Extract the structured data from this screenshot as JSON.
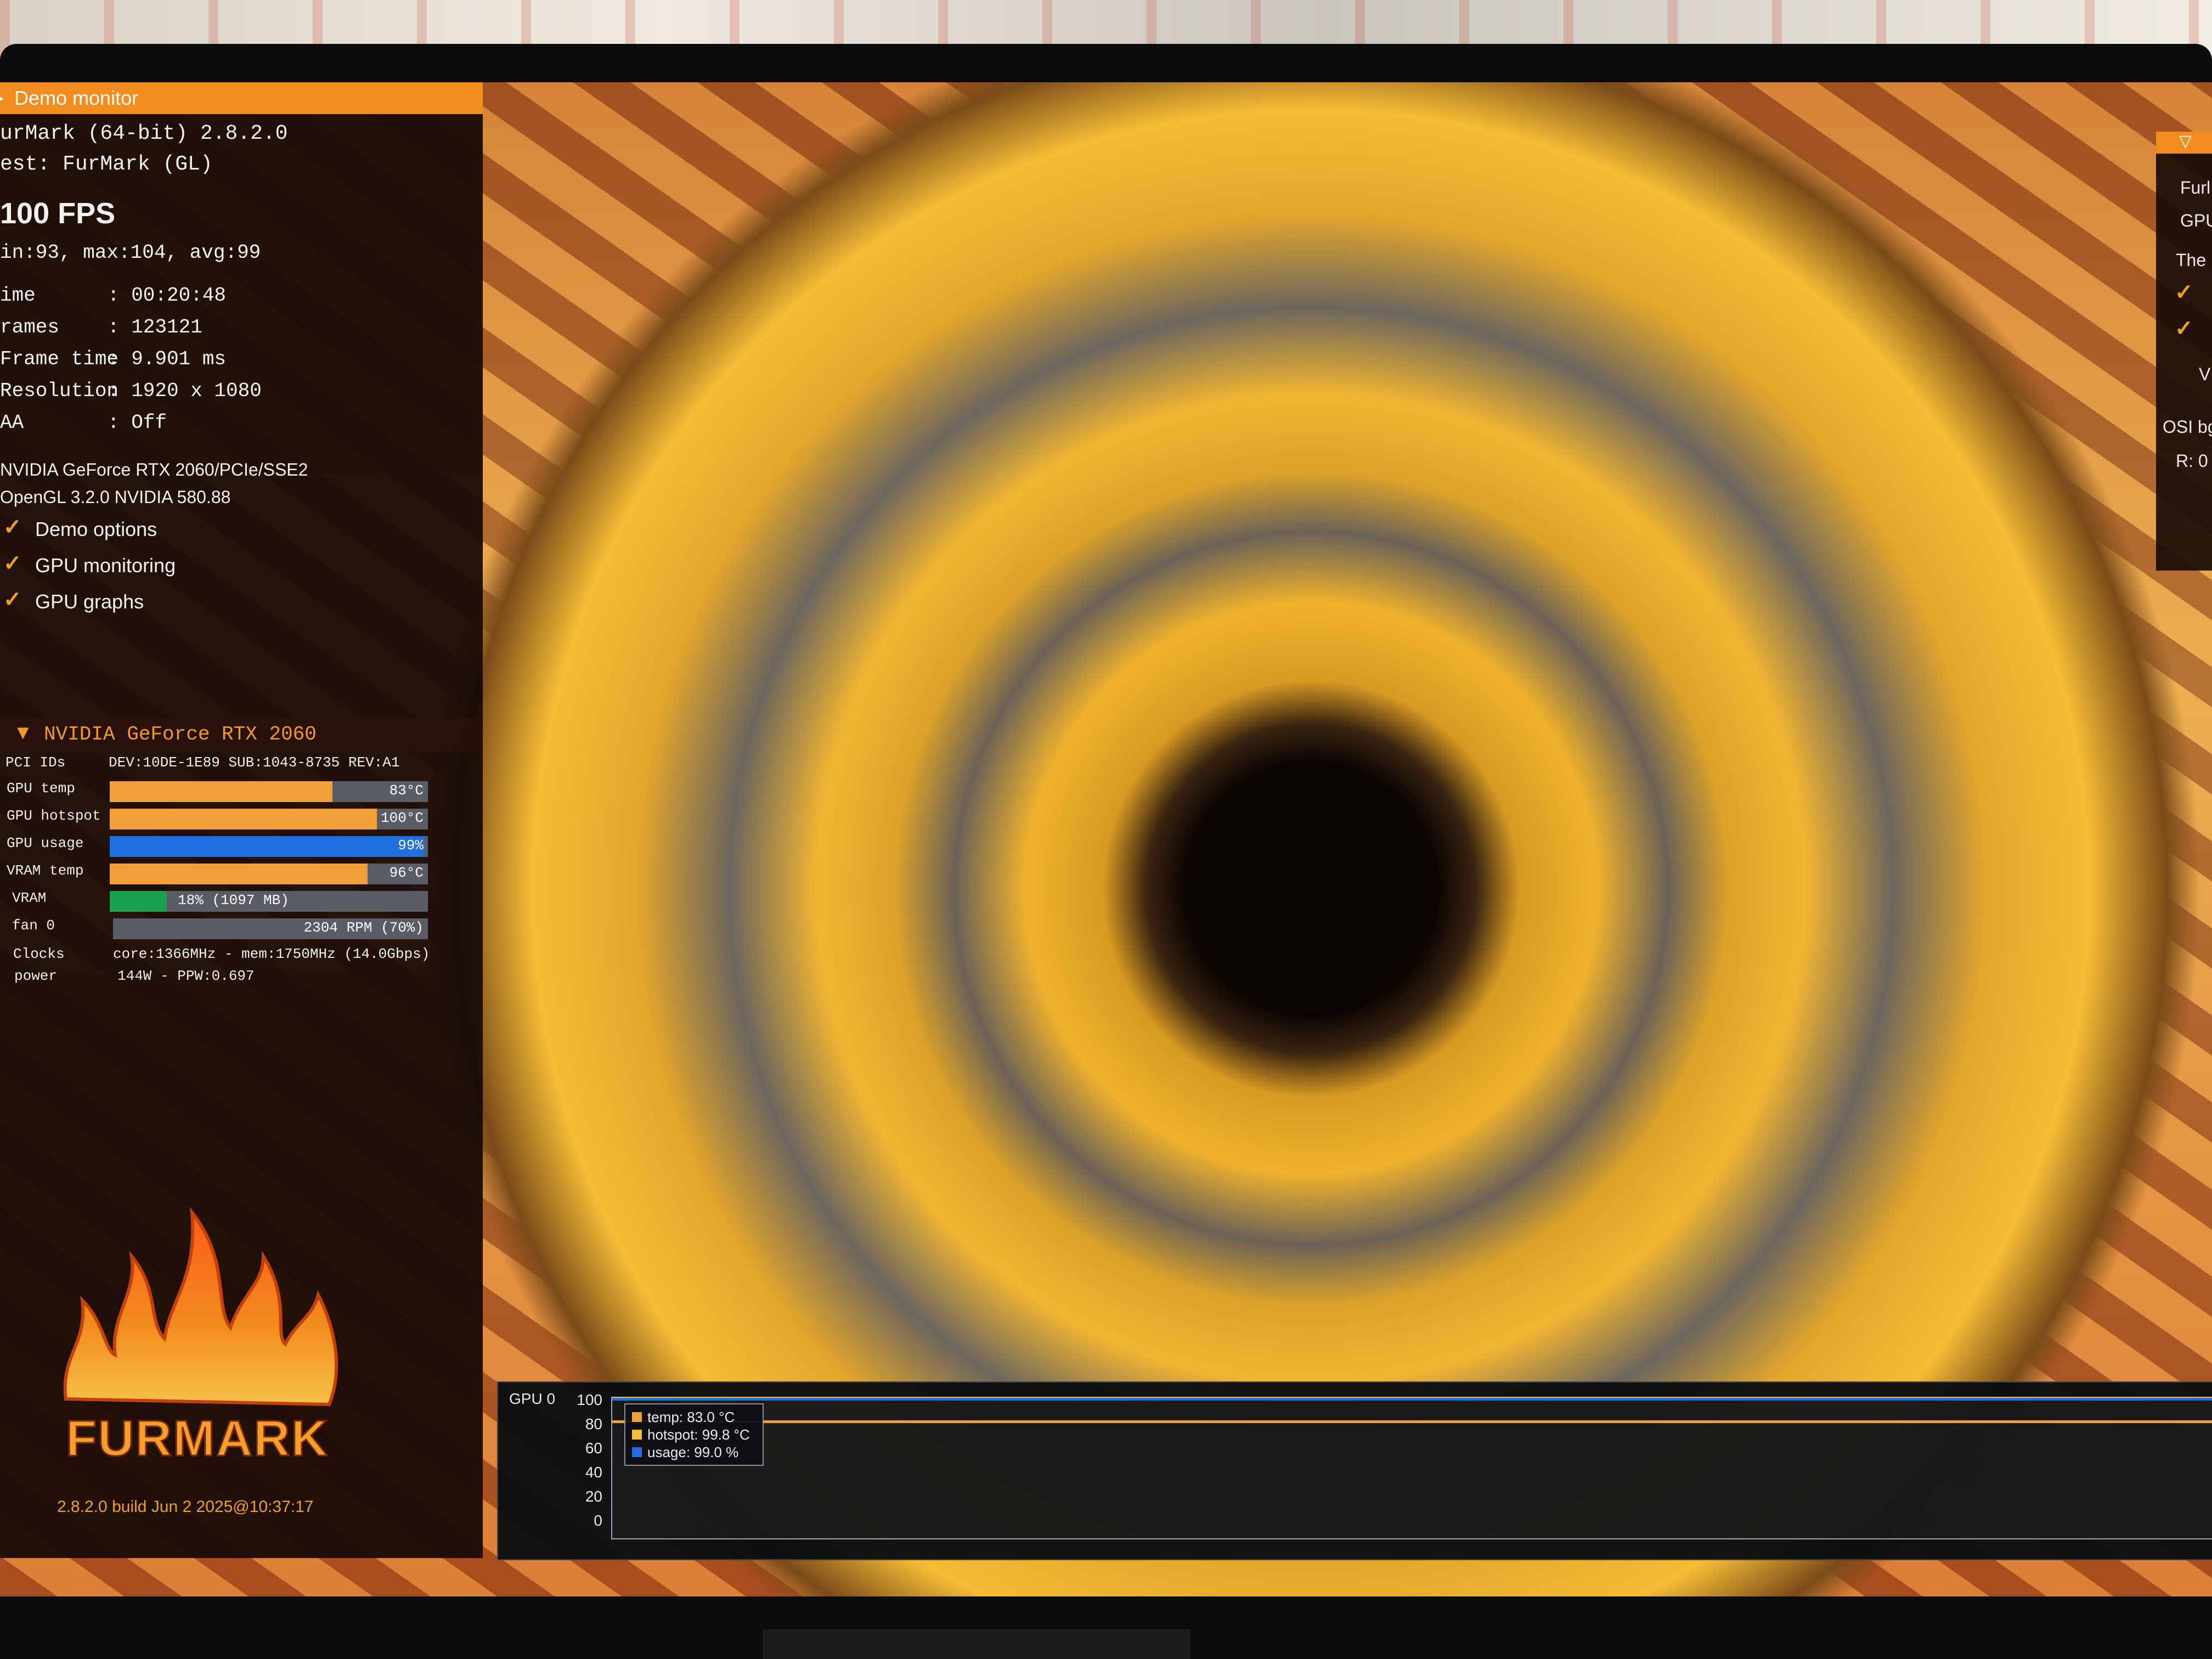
{
  "window": {
    "title": "Demo monitor"
  },
  "app": {
    "name_line": "urMark (64-bit) 2.8.2.0",
    "test_line": "est: FurMark (GL)",
    "fps": "100 FPS",
    "fps_stats": "in:93, max:104, avg:99"
  },
  "stats": [
    {
      "label": "ime",
      "value": ": 00:20:48"
    },
    {
      "label": "rames",
      "value": ": 123121"
    },
    {
      "label": "Frame time",
      "value": ": 9.901 ms"
    },
    {
      "label": "Resolution",
      "value": ": 1920 x 1080"
    },
    {
      "label": "AA",
      "value": ": Off"
    }
  ],
  "renderer": {
    "gpu_line": "NVIDIA GeForce RTX 2060/PCIe/SSE2",
    "gl_line": "OpenGL 3.2.0 NVIDIA 580.88"
  },
  "options": [
    {
      "label": "Demo options",
      "checked": true
    },
    {
      "label": "GPU monitoring",
      "checked": true
    },
    {
      "label": "GPU graphs",
      "checked": true
    }
  ],
  "gpu": {
    "header": "NVIDIA GeForce RTX 2060",
    "pci_label": "PCI IDs",
    "pci_value": "DEV:10DE-1E89 SUB:1043-8735 REV:A1",
    "bars": [
      {
        "label": "GPU temp",
        "text": "83°C",
        "fill": 0.7,
        "color": "#f2a03a"
      },
      {
        "label": "GPU hotspot",
        "text": "100°C",
        "fill": 0.84,
        "color": "#f2a03a"
      },
      {
        "label": "GPU usage",
        "text": "99%",
        "fill": 0.99,
        "color": "#1f6fe0"
      },
      {
        "label": "VRAM temp",
        "text": "96°C",
        "fill": 0.81,
        "color": "#f2a03a"
      },
      {
        "label": "VRAM",
        "text": "18% (1097 MB)",
        "fill": 0.18,
        "color": "#1aa050"
      },
      {
        "label": "fan 0",
        "text": "2304 RPM (70%)",
        "fill": 0.7,
        "color": "#5a5c66"
      }
    ],
    "clocks_label": "Clocks",
    "clocks_value": "core:1366MHz - mem:1750MHz (14.0Gbps)",
    "power_label": "power",
    "power_value": "144W - PPW:0.697"
  },
  "logo": {
    "text": "FURMARK",
    "build": "2.8.2.0 build Jun  2 2025@10:37:17"
  },
  "right_panel": {
    "lines": [
      "Furl",
      "GPU",
      "The",
      "",
      "",
      "V",
      "OSI bg",
      "R: 0"
    ]
  },
  "graph": {
    "title": "GPU 0",
    "yticks": [
      "100",
      "80",
      "60",
      "40",
      "20",
      "0"
    ],
    "legend": [
      {
        "label": "temp: 83.0 °C",
        "color": "#f2a03a",
        "value": 83.0
      },
      {
        "label": "hotspot: 99.8 °C",
        "color": "#f2c03a",
        "value": 99.8
      },
      {
        "label": "usage: 99.0 %",
        "color": "#1f6fe0",
        "value": 99.0
      }
    ]
  }
}
